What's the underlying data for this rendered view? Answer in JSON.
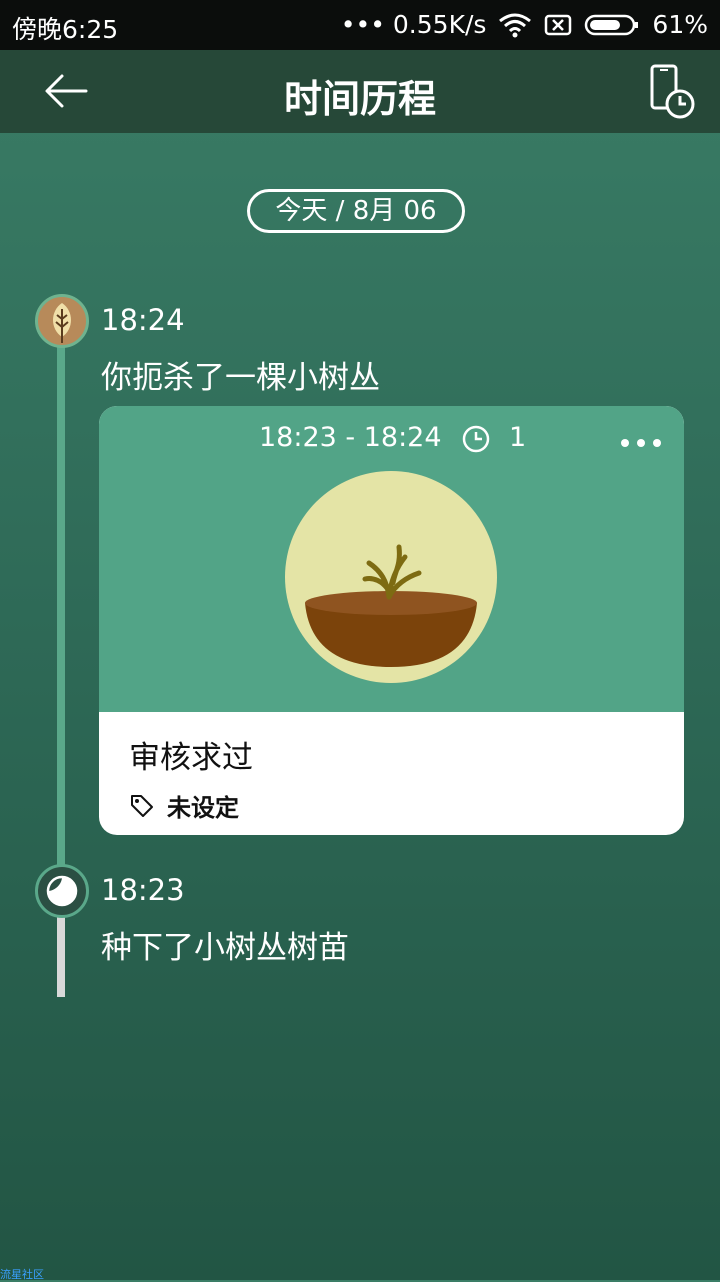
{
  "status_bar": {
    "time": "傍晚6:25",
    "network_speed": "••• 0.55K/s",
    "battery_percent": "61%",
    "icons": [
      "wifi-icon",
      "sim-blocked-icon",
      "battery-icon"
    ]
  },
  "app_bar": {
    "title": "时间历程",
    "back_icon": "arrow-left-icon",
    "action_icon": "phone-clock-icon"
  },
  "date_pill": "今天 / 8月 06",
  "events": [
    {
      "time": "18:24",
      "text": "你扼杀了一棵小树丛",
      "node_icon": "leaf-icon"
    },
    {
      "time": "18:23",
      "text": "种下了小树丛树苗",
      "node_icon": "timer-icon"
    }
  ],
  "card": {
    "range": "18:23 - 18:24",
    "count": "1",
    "name": "审核求过",
    "tag_label": "未设定",
    "more_icon": "more-dots-icon",
    "art": "withered-bush-in-pot"
  },
  "watermark": "流星社区",
  "colors": {
    "status_bar": "#0b0d0c",
    "app_bar": "#264838",
    "background": "#2f6b58",
    "card_top": "#52a487",
    "timeline_green": "#5aa88a",
    "timeline_gray": "#d9d9d9"
  }
}
